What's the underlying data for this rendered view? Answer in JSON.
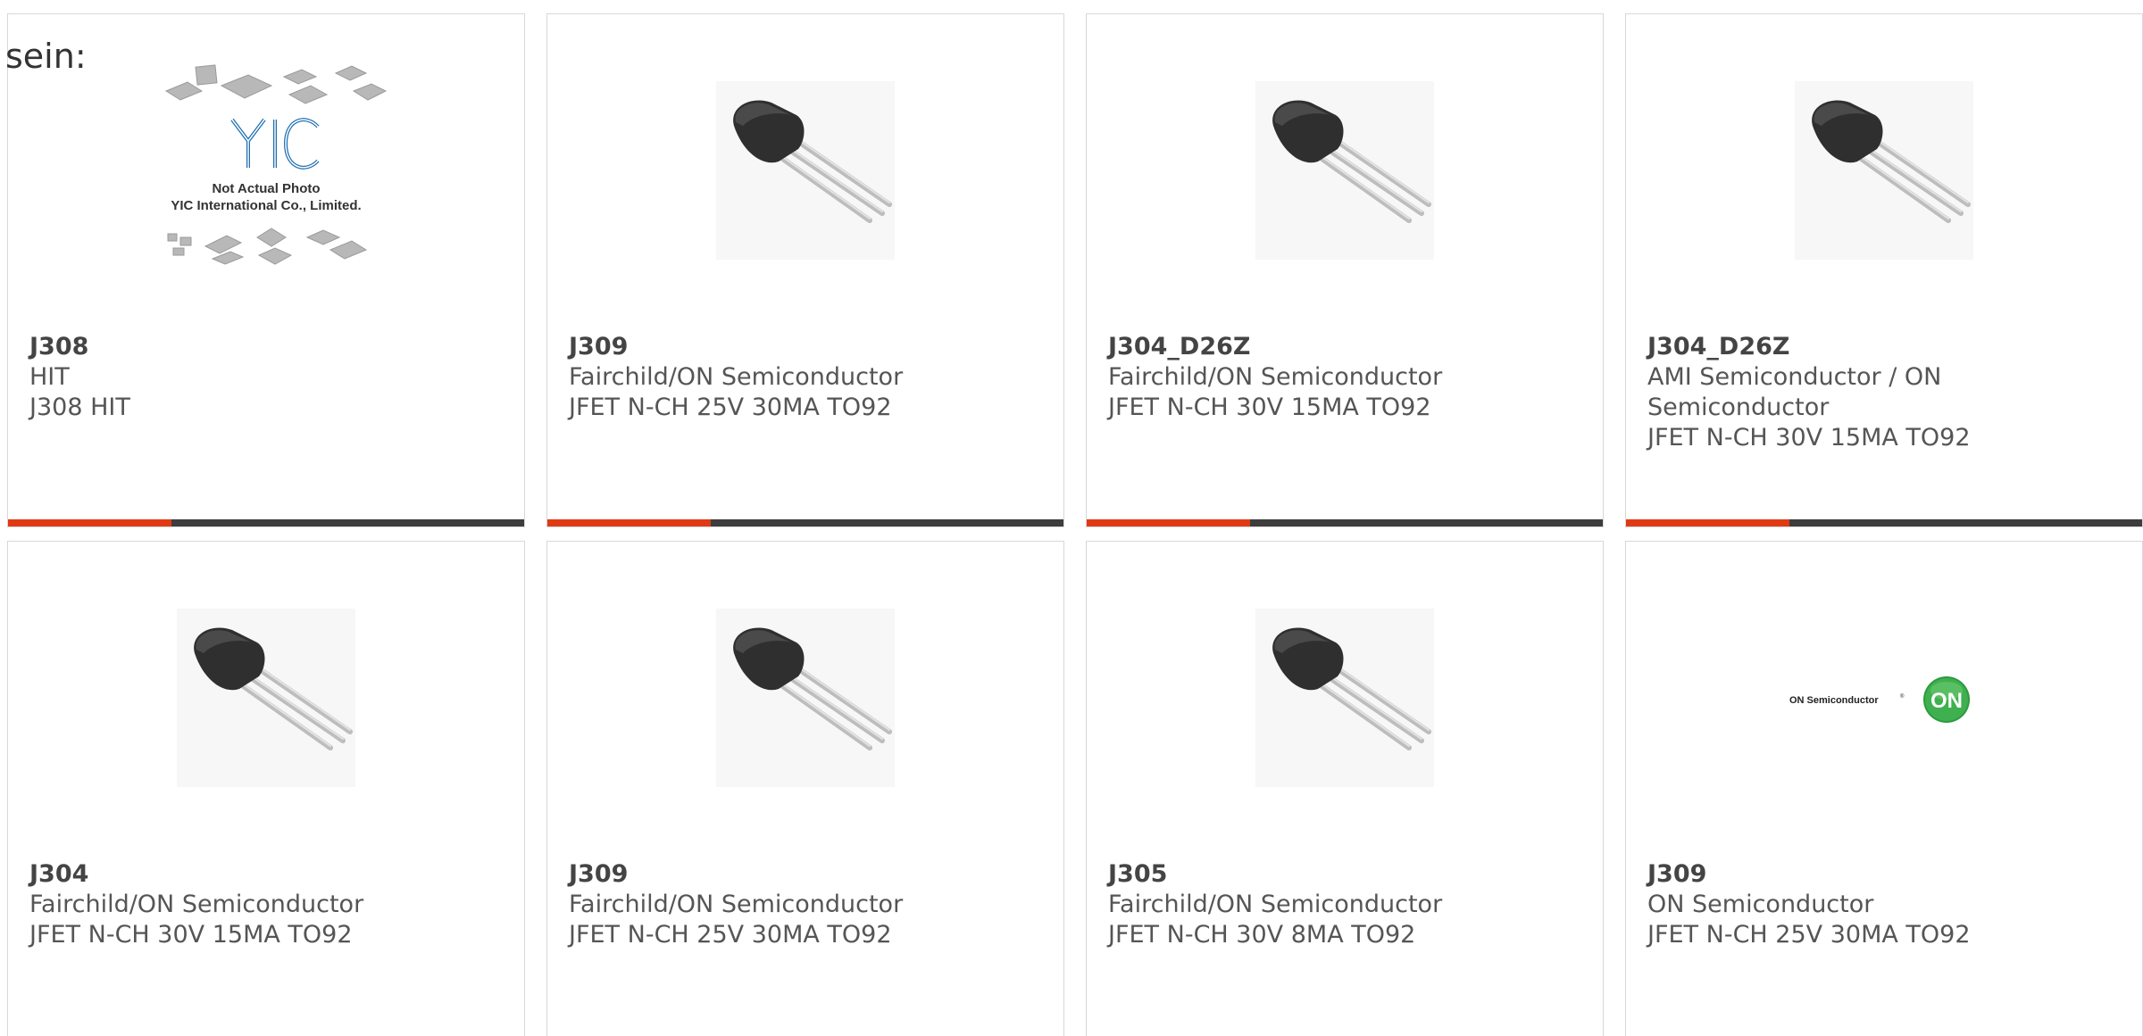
{
  "intro_text": "sein:",
  "placeholder_photo": {
    "line1": "Not Actual Photo",
    "line2": "YIC International Co., Limited."
  },
  "cards": [
    {
      "part": "J308",
      "maker": "HIT",
      "desc": "J308 HIT",
      "image": "yic-placeholder"
    },
    {
      "part": "J309",
      "maker": "Fairchild/ON Semiconductor",
      "desc": "JFET N-CH 25V 30MA TO92",
      "image": "to92-transistor"
    },
    {
      "part": "J304_D26Z",
      "maker": "Fairchild/ON Semiconductor",
      "desc": "JFET N-CH 30V 15MA TO92",
      "image": "to92-transistor"
    },
    {
      "part": "J304_D26Z",
      "maker": "AMI Semiconductor / ON Semiconductor",
      "desc": "JFET N-CH 30V 15MA TO92",
      "image": "to92-transistor"
    },
    {
      "part": "J304",
      "maker": "Fairchild/ON Semiconductor",
      "desc": "JFET N-CH 30V 15MA TO92",
      "image": "to92-transistor"
    },
    {
      "part": "J309",
      "maker": "Fairchild/ON Semiconductor",
      "desc": "JFET N-CH 25V 30MA TO92",
      "image": "to92-transistor"
    },
    {
      "part": "J305",
      "maker": "Fairchild/ON Semiconductor",
      "desc": "JFET N-CH 30V 8MA TO92",
      "image": "to92-transistor"
    },
    {
      "part": "J309",
      "maker": "ON Semiconductor",
      "desc": "JFET N-CH 25V 30MA TO92",
      "image": "on-semi-logo"
    }
  ],
  "on_logo": {
    "wordmark": "ON Semiconductor",
    "badge": "ON"
  },
  "colors": {
    "accent": "#e03a14",
    "bar_dark": "#3d3d3d"
  }
}
